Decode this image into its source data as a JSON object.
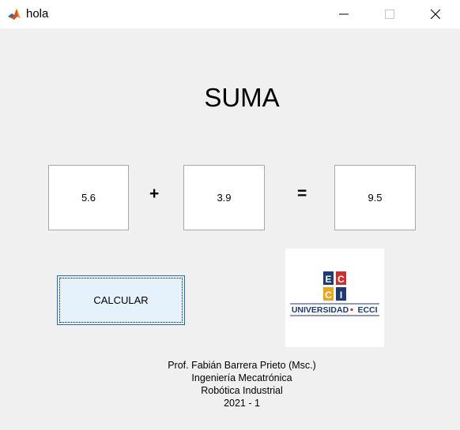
{
  "window": {
    "title": "hola",
    "icon": "matlab-icon",
    "controls": [
      "minimize-icon",
      "maximize-icon",
      "close-icon"
    ]
  },
  "main": {
    "heading": "SUMA",
    "operand_a": "5.6",
    "plus_sign": "+",
    "operand_b": "3.9",
    "equals_sign": "=",
    "result": "9.5",
    "calculate_label": "CALCULAR"
  },
  "logo": {
    "letters": [
      "E",
      "C",
      "C",
      "I"
    ],
    "caption_left": "UNIVERSIDAD",
    "caption_right": "ECCI",
    "colors": {
      "navy": "#1f3a6e",
      "red": "#c8312f",
      "gold": "#e8a81f"
    }
  },
  "credits": {
    "author": "Prof. Fabián Barrera Prieto (Msc.)",
    "program": "Ingeniería Mecatrónica",
    "course": "Robótica Industrial",
    "term": "2021 - 1"
  }
}
